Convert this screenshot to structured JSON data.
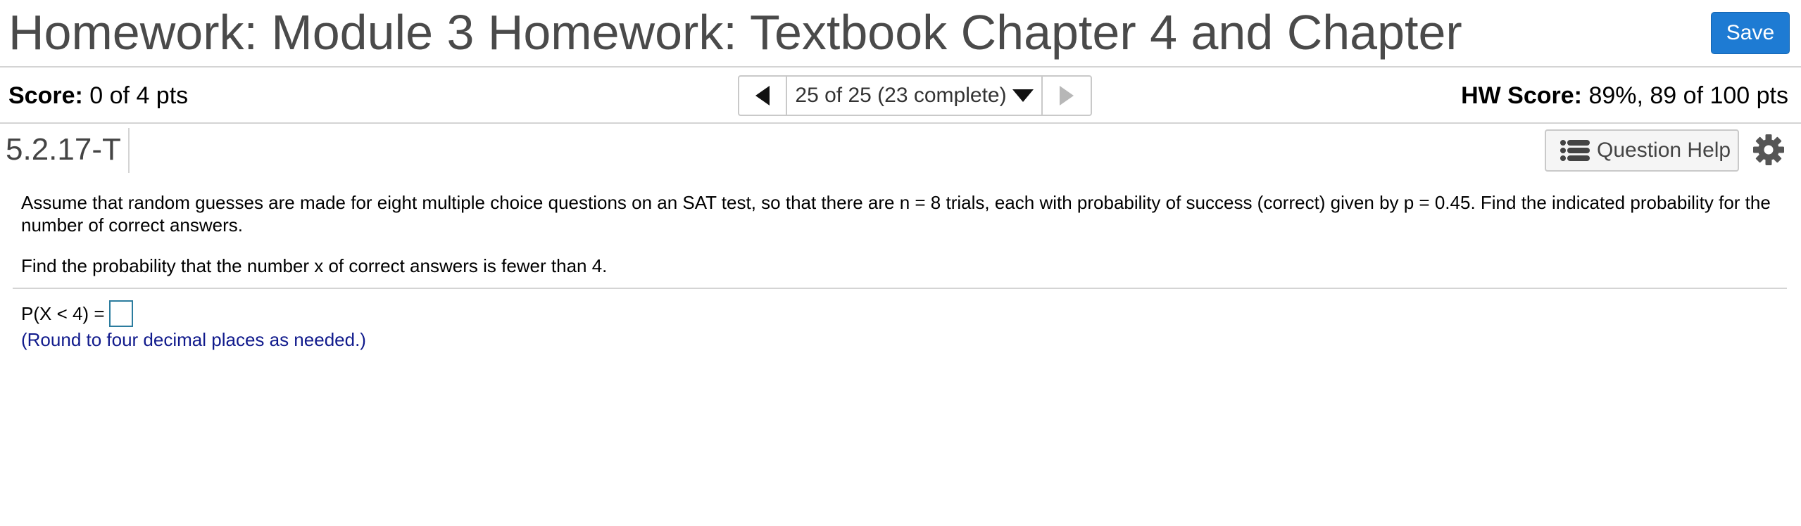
{
  "header": {
    "title": "Homework: Module 3 Homework: Textbook Chapter 4 and Chapter",
    "save_label": "Save"
  },
  "score_bar": {
    "score_label": "Score:",
    "score_value": "0 of 4 pts",
    "nav_position": "25 of 25 (23 complete)",
    "hw_score_label": "HW Score:",
    "hw_score_value": "89%, 89 of 100 pts"
  },
  "question_bar": {
    "question_id": "5.2.17-T",
    "help_label": "Question Help"
  },
  "question": {
    "prompt": "Assume that random guesses are made for eight multiple choice questions on an SAT test, so that there are n = 8 trials, each with probability of success (correct) given by p = 0.45. Find the indicated probability for the number of correct answers.",
    "task": "Find the probability that the number x of correct answers is fewer than 4.",
    "answer_label": "P(X < 4) =",
    "answer_value": "",
    "hint": "(Round to four decimal places as needed.)"
  },
  "icons": {
    "prev": "triangle-left-icon",
    "next": "triangle-right-icon",
    "dropdown": "triangle-down-icon",
    "help": "list-icon",
    "settings": "gear-icon"
  },
  "colors": {
    "save_button": "#1e7bd3",
    "hint_text": "#101a8c",
    "answer_box_border": "#2b7c9e"
  }
}
